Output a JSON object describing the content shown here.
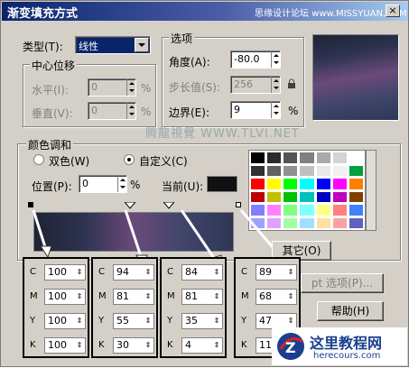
{
  "title": "渐变填充方式",
  "watermark_top": "思缘设计论坛 www.MISSYUAN.COM",
  "close_label": "×",
  "type_label": "类型(T):",
  "type_value": "线性",
  "center_group": "中心位移",
  "horiz_label": "水平(I):",
  "vert_label": "垂直(V):",
  "horiz_value": "0",
  "vert_value": "0",
  "pct": "%",
  "options_group": "选项",
  "angle_label": "角度(A):",
  "angle_value": "-80.0",
  "step_label": "步长值(S):",
  "step_value": "256",
  "edge_label": "边界(E):",
  "edge_value": "9",
  "color_group": "颜色调和",
  "two_color": "双色(W)",
  "custom": "自定义(C)",
  "position_label": "位置(P):",
  "position_value": "0",
  "current_label": "当前(U):",
  "watermark_mid": "腾龍視覺 WWW.TLVI.NET",
  "other_button": "其它(O)",
  "ps_options": "pt 选项(P)...",
  "help_button": "帮助(H)",
  "logo_text": "这里教程网",
  "logo_url": "herecours.com",
  "cmyk_labels": [
    "C",
    "M",
    "Y",
    "K"
  ],
  "cmyk_boxes": [
    {
      "values": [
        "100",
        "100",
        "100",
        "100"
      ]
    },
    {
      "values": [
        "94",
        "81",
        "55",
        "30"
      ]
    },
    {
      "values": [
        "84",
        "81",
        "35",
        "4"
      ]
    },
    {
      "values": [
        "89",
        "68",
        "47",
        "11"
      ]
    }
  ],
  "colors": {
    "gradient_stops": [
      "#1e2335",
      "#2d3350",
      "#6b4a7a",
      "#3f456a",
      "#2f3755"
    ],
    "palette": [
      "#000000",
      "#2b2b2b",
      "#555555",
      "#808080",
      "#aaaaaa",
      "#d4d4d4",
      "#ffffff",
      "#303030",
      "#606060",
      "#909090",
      "#c0c0c0",
      "#e8e8e8",
      "#f0f0f0",
      "#00a040",
      "#ff0000",
      "#ffff00",
      "#00ff00",
      "#00ffff",
      "#0000ff",
      "#ff00ff",
      "#ff8000",
      "#c00000",
      "#c0c000",
      "#00c000",
      "#00c0c0",
      "#0000c0",
      "#c000c0",
      "#804000",
      "#8080ff",
      "#ff80ff",
      "#80ff80",
      "#80ffff",
      "#ffff80",
      "#ff8080",
      "#4080ff",
      "#a0a0ff",
      "#e0a0ff",
      "#a0ffa0",
      "#a0e0ff",
      "#ffe0a0",
      "#ffa0a0",
      "#6060c0"
    ]
  }
}
